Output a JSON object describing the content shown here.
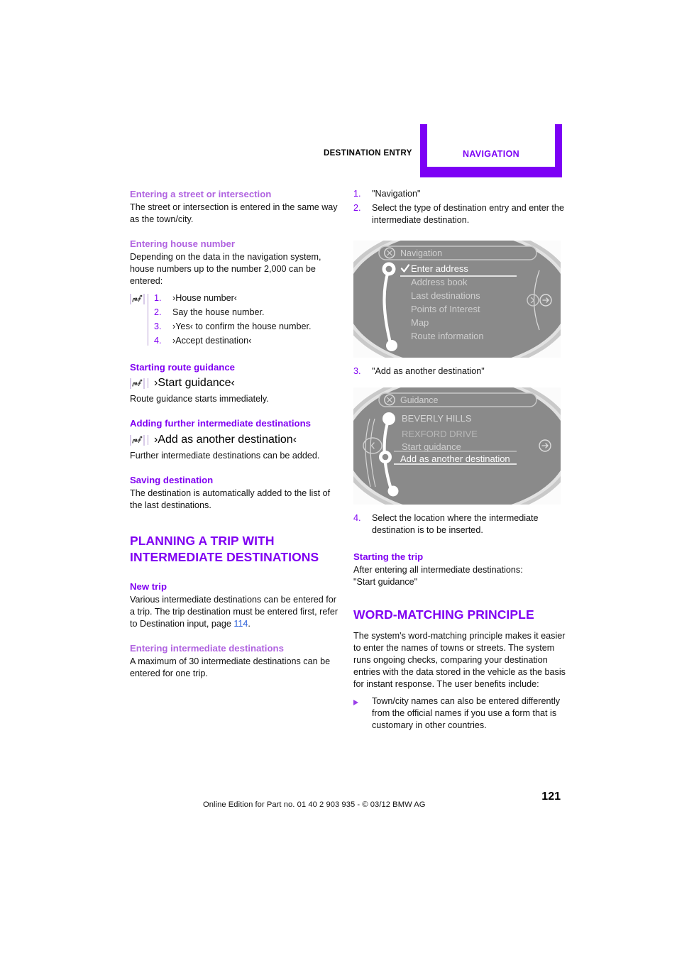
{
  "header": {
    "left_label": "DESTINATION ENTRY",
    "tab_label": "NAVIGATION",
    "accent": "#7c00f5"
  },
  "left_column": {
    "sec_street": {
      "heading": "Entering a street or intersection",
      "body": "The street or intersection is entered in the same way as the town/city."
    },
    "sec_house": {
      "heading": "Entering house number",
      "body": "Depending on the data in the navigation system, house numbers up to the number 2,000 can be entered:",
      "steps": [
        {
          "num": "1.",
          "text": "›House number‹"
        },
        {
          "num": "2.",
          "text": "Say the house number."
        },
        {
          "num": "3.",
          "text": "›Yes‹  to confirm the house number."
        },
        {
          "num": "4.",
          "text": "›Accept destination‹"
        }
      ]
    },
    "sec_start_guidance": {
      "heading": "Starting route guidance",
      "voice_command": "›Start guidance‹",
      "body": "Route guidance starts immediately."
    },
    "sec_adding": {
      "heading": "Adding further intermediate destinations",
      "voice_command": "›Add as another destination‹",
      "body": "Further intermediate destinations can be added."
    },
    "sec_saving": {
      "heading": "Saving destination",
      "body": "The destination is automatically added to the list of the last destinations."
    },
    "sec_planning": {
      "heading": "PLANNING A TRIP WITH INTERMEDIATE DESTINATIONS"
    },
    "sec_new_trip": {
      "heading": "New trip",
      "body_before_link": "Various intermediate destinations can be entered for a trip. The trip destination must be entered first, refer to Destination input, page ",
      "link": "114",
      "body_after_link": "."
    },
    "sec_entering_intermediate": {
      "heading": "Entering intermediate destinations",
      "body": "A maximum of 30 intermediate destinations can be entered for one trip."
    }
  },
  "right_column": {
    "steps_top": [
      {
        "num": "1.",
        "text": "\"Navigation\""
      },
      {
        "num": "2.",
        "text": "Select the type of destination entry and enter the intermediate destination."
      }
    ],
    "screen_navigation": {
      "title": "Navigation",
      "title_icon": "compass-icon",
      "items": [
        {
          "label": "Enter address",
          "selected": true,
          "checked": true
        },
        {
          "label": "Address book",
          "selected": false,
          "checked": false
        },
        {
          "label": "Last destinations",
          "selected": false,
          "checked": false
        },
        {
          "label": "Points of Interest",
          "selected": false,
          "checked": false
        },
        {
          "label": "Map",
          "selected": false,
          "checked": false
        },
        {
          "label": "Route information",
          "selected": false,
          "checked": false
        }
      ],
      "right_icons": [
        "chevron-right-circle-icon",
        "arrow-right-circle-icon"
      ]
    },
    "step_3": {
      "num": "3.",
      "text": "\"Add as another destination\""
    },
    "screen_guidance": {
      "title": "Guidance",
      "title_icon": "compass-icon",
      "items": [
        {
          "label": "BEVERLY HILLS",
          "selected": false,
          "node": true
        },
        {
          "label": "REXFORD DRIVE",
          "selected": false,
          "node": false
        },
        {
          "label": "Start guidance",
          "selected": false,
          "node": false
        },
        {
          "label": "Add as another destination",
          "selected": true,
          "node": true
        }
      ],
      "left_icons": [
        "chevron-left-circle-icon"
      ],
      "right_icons": [
        "arrow-right-circle-icon"
      ]
    },
    "step_4": {
      "num": "4.",
      "text": "Select the location where the intermediate destination is to be inserted."
    },
    "sec_starting_trip": {
      "heading": "Starting the trip",
      "body_line1": "After entering all intermediate destinations:",
      "body_line2": "\"Start guidance\""
    },
    "sec_word_matching": {
      "heading": "WORD-MATCHING PRINCIPLE",
      "body": "The system's word-matching principle makes it easier to enter the names of towns or streets. The system runs ongoing checks, comparing your destination entries with the data stored in the vehicle as the basis for instant response. The user benefits include:",
      "bullets": [
        "Town/city names can also be entered differently from the official names if you use a form that is customary in other countries."
      ]
    }
  },
  "footer": {
    "note": "Online Edition for Part no. 01 40 2 903 935 - © 03/12 BMW AG",
    "page_number": "121"
  },
  "colors": {
    "heading_purple": "#8000f2",
    "subheading_purple": "#b063e0",
    "link_blue": "#2b5fd9",
    "tab_purple": "#7c00f5"
  }
}
